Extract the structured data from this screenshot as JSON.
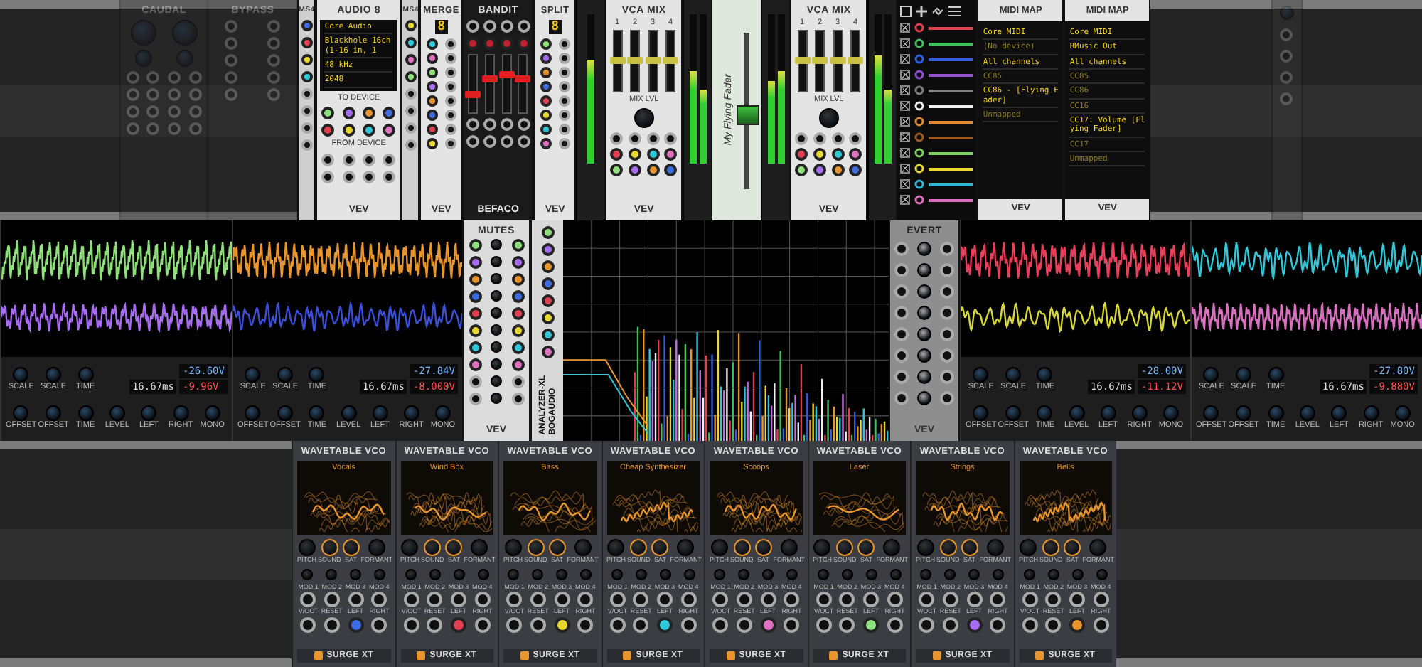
{
  "top_row": [
    {
      "kind": "blank"
    },
    {
      "kind": "caudal",
      "title": "CAUDAL"
    },
    {
      "kind": "bypass",
      "title": "BYPASS"
    },
    {
      "kind": "strip",
      "title": "MS4"
    },
    {
      "kind": "audio",
      "title": "AUDIO 8",
      "display": [
        "Core Audio",
        "Blackhole 16ch (1-16 in, 1",
        "48 kHz",
        "2048"
      ],
      "sections": [
        "TO DEVICE",
        "FROM DEVICE"
      ],
      "brand": "VEV"
    },
    {
      "kind": "strip",
      "title": "MS4"
    },
    {
      "kind": "merge",
      "title": "MERGE",
      "count": "8",
      "brand": "VEV"
    },
    {
      "kind": "bandit",
      "title": "BANDIT",
      "brand": "BEFACO",
      "sliders": [
        {
          "level": 0.3
        },
        {
          "level": 0.6
        },
        {
          "level": 0.7
        },
        {
          "level": 0.6
        }
      ]
    },
    {
      "kind": "merge",
      "title": "SPLIT",
      "count": "8",
      "brand": "VEV"
    },
    {
      "kind": "meter",
      "channels": [
        {
          "level": 0.7
        }
      ]
    },
    {
      "kind": "vcamix",
      "title": "VCA MIX",
      "knob_label": "MIX LVL",
      "brand": "VEV",
      "faders": [
        {
          "label": "1",
          "level": 0.5
        },
        {
          "label": "2",
          "level": 0.5
        },
        {
          "label": "3",
          "level": 0.5
        },
        {
          "label": "4",
          "level": 0.5
        }
      ]
    },
    {
      "kind": "meter",
      "channels": [
        {
          "level": 0.62
        },
        {
          "level": 0.5
        }
      ]
    },
    {
      "kind": "fader",
      "label": "My Flying Fader",
      "level": 0.45
    },
    {
      "kind": "meter",
      "channels": [
        {
          "level": 0.55
        },
        {
          "level": 0.62
        }
      ]
    },
    {
      "kind": "vcamix",
      "title": "VCA MIX",
      "knob_label": "MIX LVL",
      "brand": "VEV",
      "faders": [
        {
          "label": "1",
          "level": 0.5
        },
        {
          "label": "2",
          "level": 0.5
        },
        {
          "label": "3",
          "level": 0.5
        },
        {
          "label": "4",
          "level": 0.5
        }
      ]
    },
    {
      "kind": "meter",
      "channels": [
        {
          "level": 0.72
        },
        {
          "level": 0.5
        }
      ]
    },
    {
      "kind": "patch",
      "cables": [
        {
          "color": "#e04050",
          "checked": true
        },
        {
          "color": "#40c060",
          "checked": true
        },
        {
          "color": "#3060e0",
          "checked": true
        },
        {
          "color": "#9050d0",
          "checked": true
        },
        {
          "color": "#808080",
          "checked": true
        },
        {
          "color": "#f0f0f0",
          "checked": true
        },
        {
          "color": "#e08a30",
          "checked": true
        },
        {
          "color": "#a05a20",
          "checked": true
        },
        {
          "color": "#80d060",
          "checked": true
        },
        {
          "color": "#e8d830",
          "checked": true
        },
        {
          "color": "#30b8d0",
          "checked": true
        },
        {
          "color": "#e070c0",
          "checked": true
        }
      ]
    },
    {
      "kind": "midimap",
      "title": "MIDI MAP",
      "brand": "VEV",
      "lines": [
        {
          "text": "Core MIDI",
          "active": true
        },
        {
          "text": "(No device)",
          "active": false
        },
        {
          "text": "All channels",
          "active": true
        },
        {
          "text": "CC85",
          "active": false
        },
        {
          "text": "CC86 - [Flying Fader]",
          "active": true
        },
        {
          "text": "Unmapped",
          "active": false
        }
      ]
    },
    {
      "kind": "midimap",
      "title": "MIDI MAP",
      "brand": "VEV",
      "lines": [
        {
          "text": "Core MIDI",
          "active": true
        },
        {
          "text": "RMusic Out",
          "active": true
        },
        {
          "text": "All channels",
          "active": true
        },
        {
          "text": "CC85",
          "active": false
        },
        {
          "text": "CC86",
          "active": false
        },
        {
          "text": "CC16",
          "active": false
        },
        {
          "text": "CC17: Volume [Flying Fader]",
          "active": true
        },
        {
          "text": "CC17",
          "active": false
        },
        {
          "text": "Unmapped",
          "active": false
        }
      ]
    },
    {
      "kind": "blank"
    },
    {
      "kind": "dimpanel"
    },
    {
      "kind": "blank"
    }
  ],
  "middle_row": [
    {
      "kind": "scope",
      "traces": [
        {
          "color": "#8ee07a"
        },
        {
          "color": "#a86cf0"
        }
      ],
      "time": "16.67ms",
      "readings": [
        "-26.60V",
        "-9.96V"
      ],
      "top_labels": [
        "SCALE",
        "SCALE",
        "TIME"
      ],
      "bottom_labels": [
        "OFFSET",
        "OFFSET",
        "TIME",
        "LEVEL",
        "LEFT",
        "RIGHT",
        "MONO"
      ]
    },
    {
      "kind": "scope",
      "traces": [
        {
          "color": "#e8952e"
        },
        {
          "color": "#3c4fd8"
        }
      ],
      "time": "16.67ms",
      "readings": [
        "-27.84V",
        "-8.000V"
      ],
      "top_labels": [
        "SCALE",
        "SCALE",
        "TIME"
      ],
      "bottom_labels": [
        "OFFSET",
        "OFFSET",
        "TIME",
        "LEVEL",
        "LEFT",
        "RIGHT",
        "MONO"
      ]
    },
    {
      "kind": "mutes",
      "title": "MUTES",
      "brand": "VEV"
    },
    {
      "kind": "analyzer",
      "title": "ANALYZER-XL",
      "brand": "BOGAUDIO"
    },
    {
      "kind": "evert",
      "title": "EVERT",
      "brand": "VEV"
    },
    {
      "kind": "scope",
      "traces": [
        {
          "color": "#e8405a"
        },
        {
          "color": "#d8d838"
        }
      ],
      "time": "16.67ms",
      "readings": [
        "-28.00V",
        "-11.12V"
      ],
      "top_labels": [
        "SCALE",
        "SCALE",
        "TIME"
      ],
      "bottom_labels": [
        "OFFSET",
        "OFFSET",
        "TIME",
        "LEVEL",
        "LEFT",
        "RIGHT",
        "MONO"
      ]
    },
    {
      "kind": "scope",
      "traces": [
        {
          "color": "#30c8d8"
        },
        {
          "color": "#d870c0"
        }
      ],
      "time": "16.67ms",
      "readings": [
        "-27.80V",
        "-9.880V"
      ],
      "top_labels": [
        "SCALE",
        "SCALE",
        "TIME"
      ],
      "bottom_labels": [
        "OFFSET",
        "OFFSET",
        "TIME",
        "LEVEL",
        "LEFT",
        "RIGHT",
        "MONO"
      ]
    }
  ],
  "bottom_row": [
    {
      "kind": "blank"
    },
    {
      "kind": "vco",
      "title": "WAVETABLE VCO",
      "wavetable": "Vocals",
      "knobs": [
        "PITCH",
        "SOUND",
        "SAT",
        "FORMANT"
      ],
      "jacks": [
        "MOD 1",
        "MOD 2",
        "MOD 3",
        "MOD 4",
        "V/OCT",
        "RESET",
        "LEFT",
        "RIGHT"
      ],
      "brand": "SURGE XT"
    },
    {
      "kind": "vco",
      "title": "WAVETABLE VCO",
      "wavetable": "Wind Box",
      "knobs": [
        "PITCH",
        "SOUND",
        "SAT",
        "FORMANT"
      ],
      "jacks": [
        "MOD 1",
        "MOD 2",
        "MOD 3",
        "MOD 4",
        "V/OCT",
        "RESET",
        "LEFT",
        "RIGHT"
      ],
      "brand": "SURGE XT"
    },
    {
      "kind": "vco",
      "title": "WAVETABLE VCO",
      "wavetable": "Bass",
      "knobs": [
        "PITCH",
        "SOUND",
        "SAT",
        "FORMANT"
      ],
      "jacks": [
        "MOD 1",
        "MOD 2",
        "MOD 3",
        "MOD 4",
        "V/OCT",
        "RESET",
        "LEFT",
        "RIGHT"
      ],
      "brand": "SURGE XT"
    },
    {
      "kind": "vco",
      "title": "WAVETABLE VCO",
      "wavetable": "Cheap Synthesizer",
      "knobs": [
        "PITCH",
        "SOUND",
        "SAT",
        "FORMANT"
      ],
      "jacks": [
        "MOD 1",
        "MOD 2",
        "MOD 3",
        "MOD 4",
        "V/OCT",
        "RESET",
        "LEFT",
        "RIGHT"
      ],
      "brand": "SURGE XT"
    },
    {
      "kind": "vco",
      "title": "WAVETABLE VCO",
      "wavetable": "Scoops",
      "knobs": [
        "PITCH",
        "SOUND",
        "SAT",
        "FORMANT"
      ],
      "jacks": [
        "MOD 1",
        "MOD 2",
        "MOD 3",
        "MOD 4",
        "V/OCT",
        "RESET",
        "LEFT",
        "RIGHT"
      ],
      "brand": "SURGE XT"
    },
    {
      "kind": "vco",
      "title": "WAVETABLE VCO",
      "wavetable": "Laser",
      "knobs": [
        "PITCH",
        "SOUND",
        "SAT",
        "FORMANT"
      ],
      "jacks": [
        "MOD 1",
        "MOD 2",
        "MOD 3",
        "MOD 4",
        "V/OCT",
        "RESET",
        "LEFT",
        "RIGHT"
      ],
      "brand": "SURGE XT"
    },
    {
      "kind": "vco",
      "title": "WAVETABLE VCO",
      "wavetable": "Strings",
      "knobs": [
        "PITCH",
        "SOUND",
        "SAT",
        "FORMANT"
      ],
      "jacks": [
        "MOD 1",
        "MOD 2",
        "MOD 3",
        "MOD 4",
        "V/OCT",
        "RESET",
        "LEFT",
        "RIGHT"
      ],
      "brand": "SURGE XT"
    },
    {
      "kind": "vco",
      "title": "WAVETABLE VCO",
      "wavetable": "Bells",
      "knobs": [
        "PITCH",
        "SOUND",
        "SAT",
        "FORMANT"
      ],
      "jacks": [
        "MOD 1",
        "MOD 2",
        "MOD 3",
        "MOD 4",
        "V/OCT",
        "RESET",
        "LEFT",
        "RIGHT"
      ],
      "brand": "SURGE XT"
    },
    {
      "kind": "blank"
    }
  ]
}
